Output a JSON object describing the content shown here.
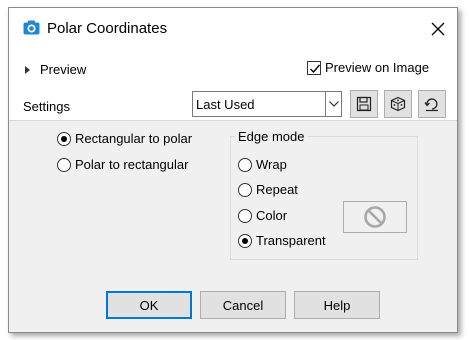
{
  "window": {
    "title": "Polar Coordinates",
    "close_icon": "close-icon"
  },
  "preview": {
    "label": "Preview",
    "preview_on_image_label": "Preview on Image",
    "preview_on_image_checked": true
  },
  "settings": {
    "label": "Settings",
    "selected_value": "Last Used",
    "tool_icons": [
      "save-icon",
      "randomize-dice-icon",
      "reset-icon"
    ]
  },
  "conversion": {
    "options": [
      "Rectangular to polar",
      "Polar to rectangular"
    ],
    "selected": "Rectangular to polar"
  },
  "edge_mode": {
    "legend": "Edge mode",
    "options": [
      "Wrap",
      "Repeat",
      "Color",
      "Transparent"
    ],
    "selected": "Transparent",
    "color_swatch_icon": "no-color-icon"
  },
  "buttons": {
    "ok": "OK",
    "cancel": "Cancel",
    "help": "Help"
  },
  "colors": {
    "dialog_bg": "#f0f0f0",
    "accent": "#0078d7",
    "app_icon": "#1e88d4"
  }
}
